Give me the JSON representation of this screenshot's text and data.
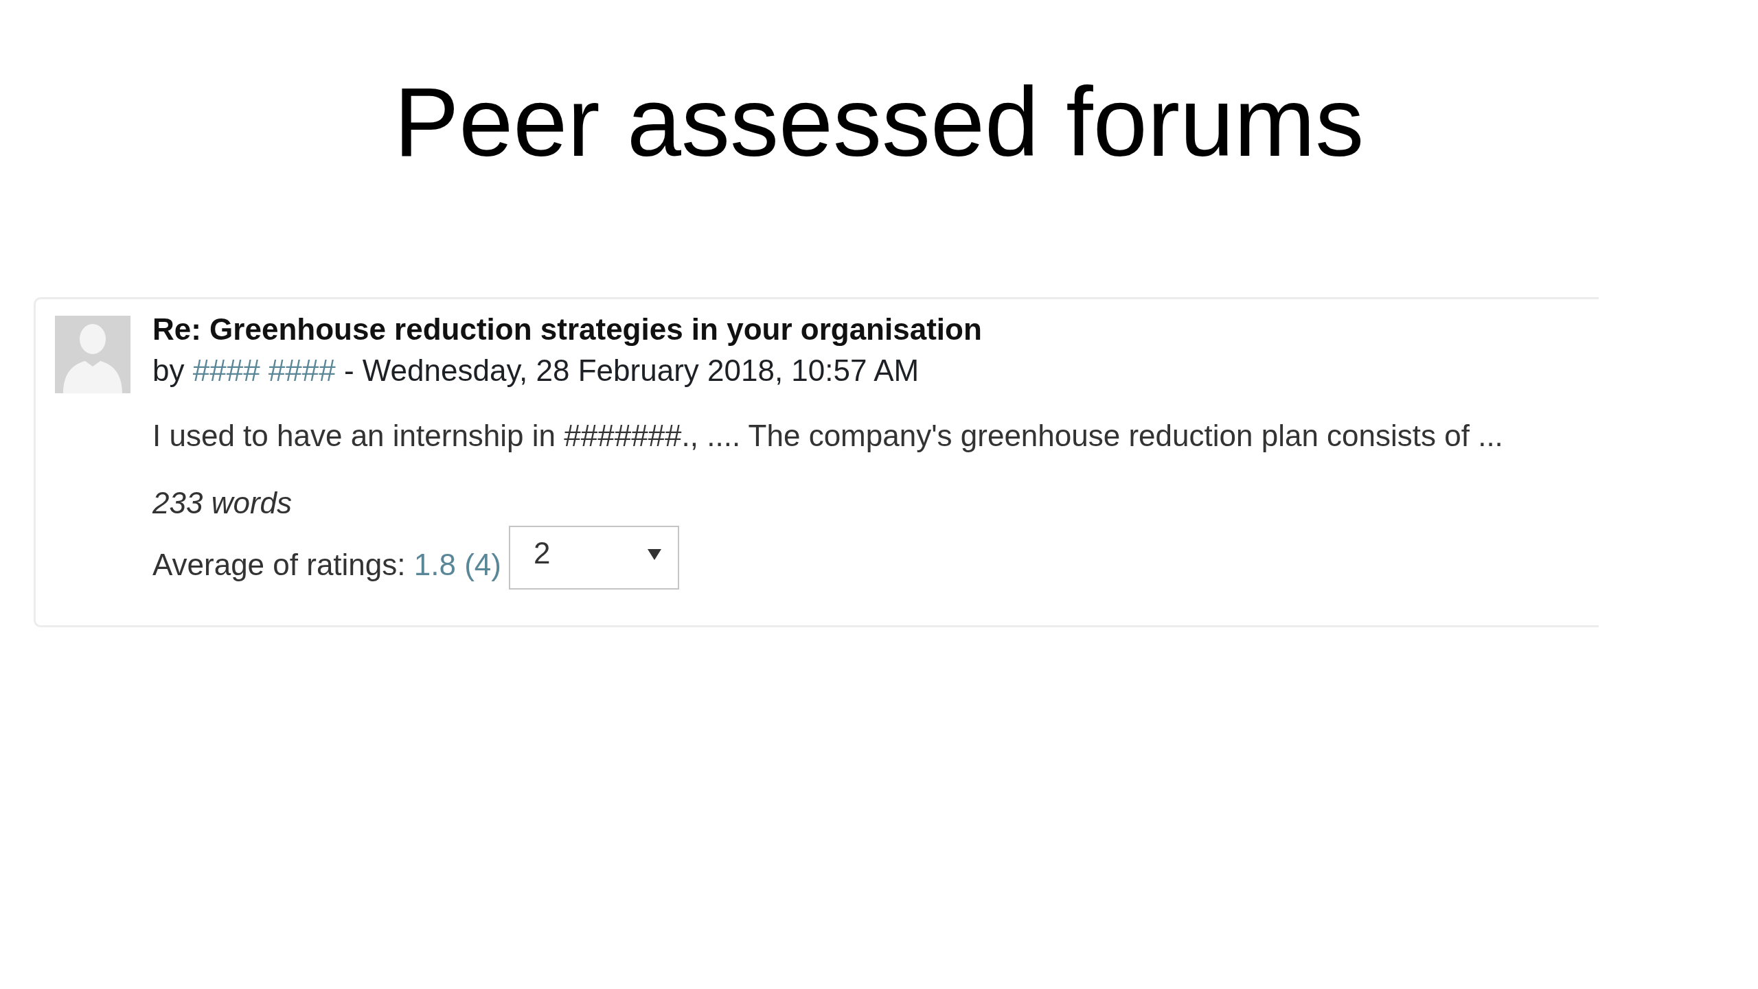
{
  "slide_title": "Peer assessed forums",
  "post": {
    "subject": "Re: Greenhouse reduction strategies in your organisation",
    "byline": {
      "prefix": "by",
      "author": "#### ####",
      "posted": "- Wednesday, 28 February 2018, 10:57 AM"
    },
    "body": "I used to have an internship in #######., .... The company's greenhouse reduction plan consists of ...",
    "word_count": "233 words",
    "rating": {
      "label": "Average of ratings:",
      "average": "1.8 (4)",
      "select": {
        "value": "2"
      }
    }
  }
}
